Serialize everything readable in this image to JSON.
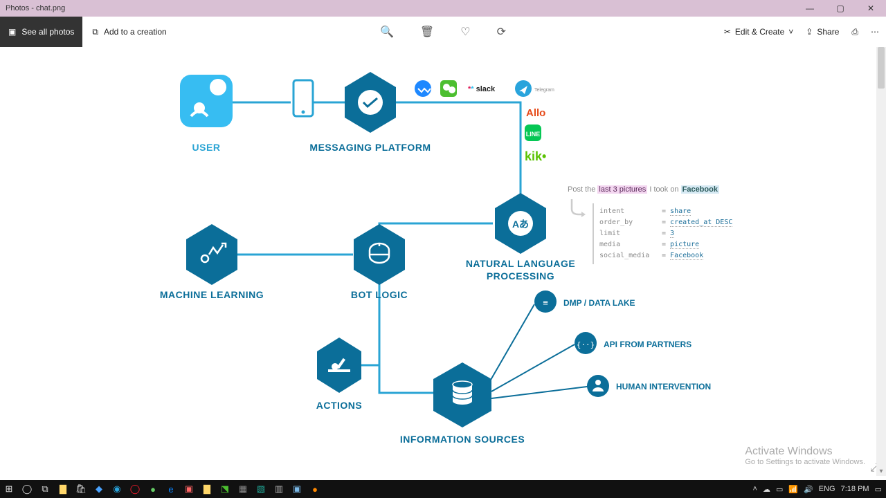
{
  "window": {
    "title": "Photos - chat.png"
  },
  "toolbar": {
    "see_all": "See all photos",
    "add_creation": "Add to a creation",
    "edit_create": "Edit & Create",
    "share": "Share"
  },
  "diagram": {
    "user": "USER",
    "messaging": "MESSAGING PLATFORM",
    "ml": "MACHINE LEARNING",
    "botlogic": "BOT LOGIC",
    "nlp1": "NATURAL LANGUAGE",
    "nlp2": "PROCESSING",
    "actions": "ACTIONS",
    "info_sources": "INFORMATION SOURCES",
    "dmp": "DMP / DATA LAKE",
    "api": "API FROM PARTNERS",
    "human": "HUMAN INTERVENTION"
  },
  "platforms": {
    "fb": "Facebook Messenger",
    "wechat": "WeChat",
    "slack": "slack",
    "telegram": "Telegram",
    "allo": "Allo",
    "line": "LINE",
    "kik": "kik"
  },
  "nlp_sample": {
    "prefix": "Post the ",
    "hl": "last 3 pictures",
    "mid": " I took on ",
    "fb": "Facebook",
    "code": [
      {
        "k": "intent",
        "v": "share"
      },
      {
        "k": "order_by",
        "v": "created_at DESC"
      },
      {
        "k": "limit",
        "v": "3"
      },
      {
        "k": "media",
        "v": "picture"
      },
      {
        "k": "social_media",
        "v": "Facebook"
      }
    ]
  },
  "activate": {
    "l1": "Activate Windows",
    "l2": "Go to Settings to activate Windows."
  },
  "systray": {
    "lang": "ENG",
    "time": "7:18 PM"
  }
}
